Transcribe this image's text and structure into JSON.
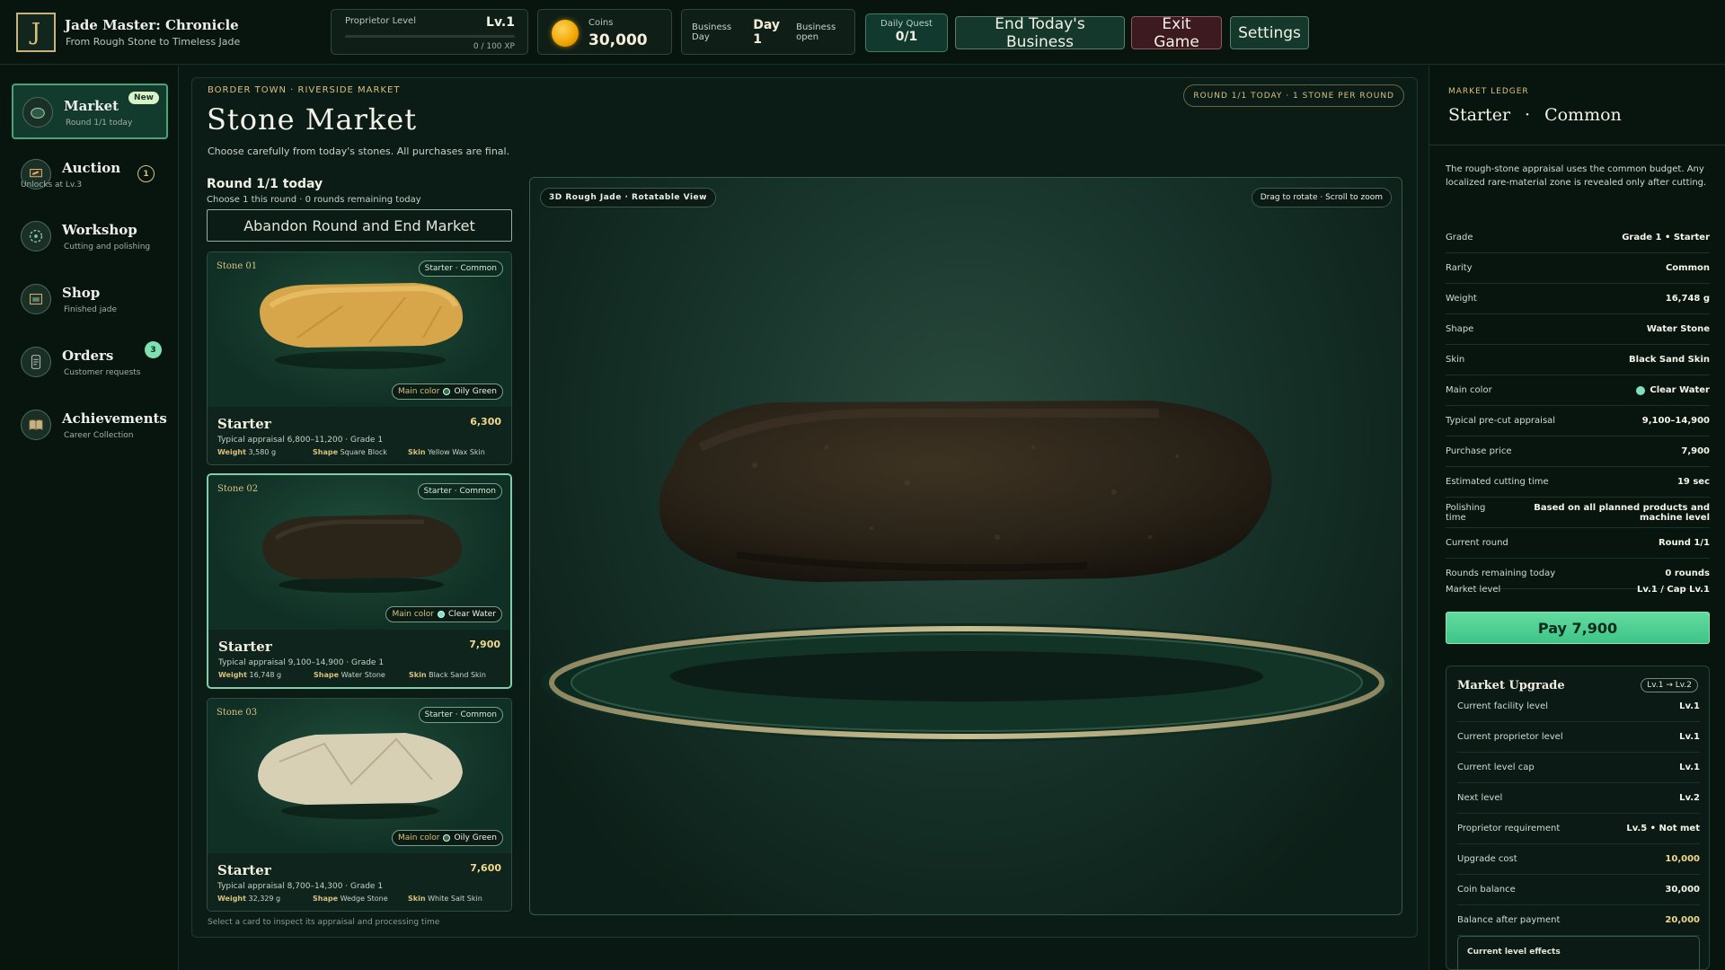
{
  "header": {
    "logo_letter": "J",
    "title": "Jade Master: Chronicle",
    "subtitle": "From Rough Stone to Timeless Jade",
    "proprietor": {
      "label": "Proprietor Level",
      "level": "Lv.1",
      "xp": "0 / 100 XP",
      "xp_progress": 0.0
    },
    "coins": {
      "label": "Coins",
      "value": "30,000"
    },
    "day": {
      "label": "Business Day",
      "value": "Day 1",
      "status": "Business open"
    },
    "quest": {
      "label": "Daily Quest",
      "value": "0/1"
    },
    "buttons": {
      "end": "End Today's Business",
      "exit": "Exit Game",
      "settings": "Settings"
    }
  },
  "sidebar": {
    "items": [
      {
        "label": "Market",
        "sub": "Round 1/1 today",
        "badge": "New",
        "icon": "market-icon"
      },
      {
        "label": "Auction",
        "sub": "Unlocks at Lv.3",
        "badge": "1",
        "icon": "gavel-icon"
      },
      {
        "label": "Workshop",
        "sub": "Cutting and polishing",
        "badge": "",
        "icon": "saw-icon"
      },
      {
        "label": "Shop",
        "sub": "Finished jade",
        "badge": "",
        "icon": "storefront-icon"
      },
      {
        "label": "Orders",
        "sub": "Customer requests",
        "badge": "3",
        "icon": "scroll-icon"
      },
      {
        "label": "Achievements",
        "sub": "Career Collection",
        "badge": "",
        "icon": "book-icon"
      }
    ]
  },
  "market": {
    "breadcrumb": "BORDER TOWN · RIVERSIDE MARKET",
    "title": "Stone Market",
    "description": "Choose carefully from today's stones. All purchases are final.",
    "round_pill": "ROUND 1/1 TODAY · 1 STONE PER ROUND",
    "round_title": "Round 1/1 today",
    "round_sub": "Choose 1 this round · 0 rounds remaining today",
    "abandon_label": "Abandon Round and End Market",
    "hint": "Select a card to inspect its appraisal and processing time",
    "stones": [
      {
        "no": "Stone 01",
        "tag": "Starter · Common",
        "mc_label": "Main color",
        "mc_value": "Oily Green",
        "name": "Starter",
        "price": "6,300",
        "appraisal": "Typical appraisal 6,800–11,200 · Grade 1",
        "w_k": "Weight",
        "w_v": "3,580 g",
        "s_k": "Shape",
        "s_v": "Square Block",
        "k_k": "Skin",
        "k_v": "Yellow Wax Skin"
      },
      {
        "no": "Stone 02",
        "tag": "Starter · Common",
        "mc_label": "Main color",
        "mc_value": "Clear Water",
        "name": "Starter",
        "price": "7,900",
        "appraisal": "Typical appraisal 9,100–14,900 · Grade 1",
        "w_k": "Weight",
        "w_v": "16,748 g",
        "s_k": "Shape",
        "s_v": "Water Stone",
        "k_k": "Skin",
        "k_v": "Black Sand Skin"
      },
      {
        "no": "Stone 03",
        "tag": "Starter · Common",
        "mc_label": "Main color",
        "mc_value": "Oily Green",
        "name": "Starter",
        "price": "7,600",
        "appraisal": "Typical appraisal 8,700–14,300 · Grade 1",
        "w_k": "Weight",
        "w_v": "32,329 g",
        "s_k": "Shape",
        "s_v": "Wedge Stone",
        "k_k": "Skin",
        "k_v": "White Salt Skin"
      }
    ]
  },
  "viewer": {
    "label": "3D Rough Jade · Rotatable View",
    "hint": "Drag to rotate · Scroll to zoom"
  },
  "ledger": {
    "kicker": "MARKET LEDGER",
    "title_a": "Starter",
    "title_sep": "·",
    "title_b": "Common",
    "description": "The rough-stone appraisal uses the common budget. Any localized rare-material zone is revealed only after cutting.",
    "rows": [
      {
        "k": "Grade",
        "v": "Grade 1 • Starter"
      },
      {
        "k": "Rarity",
        "v": "Common"
      },
      {
        "k": "Weight",
        "v": "16,748 g"
      },
      {
        "k": "Shape",
        "v": "Water Stone"
      },
      {
        "k": "Skin",
        "v": "Black Sand Skin"
      },
      {
        "k": "Main color",
        "v": "Clear Water"
      },
      {
        "k": "Typical pre-cut appraisal",
        "v": "9,100–14,900"
      },
      {
        "k": "Purchase price",
        "v": "7,900"
      },
      {
        "k": "Estimated cutting time",
        "v": "19 sec"
      },
      {
        "k": "Polishing time",
        "v": "Based on all planned products and machine level"
      },
      {
        "k": "Current round",
        "v": "Round 1/1"
      },
      {
        "k": "Rounds remaining today",
        "v": "0 rounds"
      },
      {
        "k": "Market level",
        "v": "Lv.1 / Cap Lv.1"
      }
    ],
    "pay_label": "Pay 7,900",
    "upgrade": {
      "title": "Market Upgrade",
      "pill": "Lv.1 → Lv.2",
      "rows": [
        {
          "k": "Current facility level",
          "v": "Lv.1"
        },
        {
          "k": "Current proprietor level",
          "v": "Lv.1"
        },
        {
          "k": "Current level cap",
          "v": "Lv.1"
        },
        {
          "k": "Next level",
          "v": "Lv.2"
        },
        {
          "k": "Proprietor requirement",
          "v": "Lv.5 • Not met"
        },
        {
          "k": "Upgrade cost",
          "v": "10,000"
        },
        {
          "k": "Coin balance",
          "v": "30,000"
        },
        {
          "k": "Balance after payment",
          "v": "20,000"
        }
      ],
      "effects": "Current level effects"
    }
  },
  "colors": {
    "accent_gold": "#d8c07f",
    "accent_green": "#3ec487",
    "clear_water": "#7fe0c0",
    "oily_green": "#3f6b4a"
  }
}
